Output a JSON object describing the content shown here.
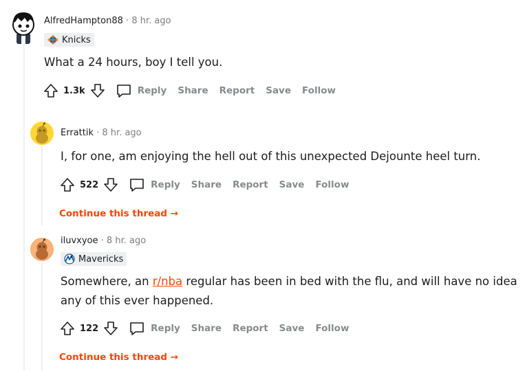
{
  "comments": [
    {
      "username": "AlfredHampton88",
      "separator": "·",
      "time": "8 hr. ago",
      "flair": "Knicks",
      "body": "What a 24 hours, boy I tell you.",
      "score": "1.3k",
      "actions": {
        "reply": "Reply",
        "share": "Share",
        "report": "Report",
        "save": "Save",
        "follow": "Follow"
      }
    },
    {
      "username": "Errattik",
      "separator": "·",
      "time": "8 hr. ago",
      "body": "I, for one, am enjoying the hell out of this unexpected Dejounte heel turn.",
      "score": "522",
      "actions": {
        "reply": "Reply",
        "share": "Share",
        "report": "Report",
        "save": "Save",
        "follow": "Follow"
      },
      "continue": "Continue this thread"
    },
    {
      "username": "iluvxyoe",
      "separator": "·",
      "time": "8 hr. ago",
      "flair": "Mavericks",
      "body_pre": "Somewhere, an ",
      "body_link": "r/nba",
      "body_line1_post": " regular has been in bed with the flu, and will have no idea",
      "body_line2": "any of this ever happened.",
      "score": "122",
      "actions": {
        "reply": "Reply",
        "share": "Share",
        "report": "Report",
        "save": "Save",
        "follow": "Follow"
      },
      "continue": "Continue this thread"
    }
  ],
  "colors": {
    "accent": "#ff4500",
    "meta": "#7c7c7c",
    "action": "#878a8c",
    "flair_bg": "#edeff1"
  }
}
